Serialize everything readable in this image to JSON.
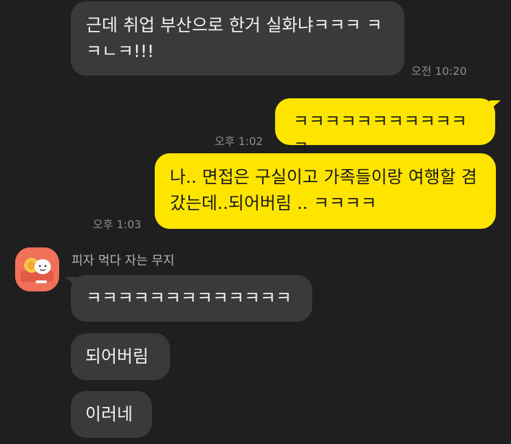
{
  "messages": {
    "m1": {
      "text": "근데 취업 부산으로 한거 실화냐ㅋㅋㅋ ㅋㅋㄴㅋ!!!",
      "time": "오전 10:20"
    },
    "m2": {
      "text": "ㅋㅋㅋㅋㅋㅋㅋㅋㅋㅋㅋㅋ",
      "time": "오후 1:02"
    },
    "m3": {
      "text": "나.. 면접은 구실이고 가족들이랑 여행할 겸 갔는데..되어버림 .. ㅋㅋㅋㅋ",
      "time": "오후 1:03"
    },
    "sender": "피자 먹다 자는 무지",
    "m4": {
      "text": "ㅋㅋㅋㅋㅋㅋㅋㅋㅋㅋㅋㅋㅋ"
    },
    "m5": {
      "text": "되어버림"
    },
    "m6": {
      "text": "이러네"
    }
  },
  "colors": {
    "background": "#1f1f1f",
    "incoming_bubble": "#3a3a3c",
    "outgoing_bubble": "#fee500",
    "avatar": "#f0705a"
  },
  "icons": {
    "avatar": "muzi-pizza-avatar-icon"
  }
}
